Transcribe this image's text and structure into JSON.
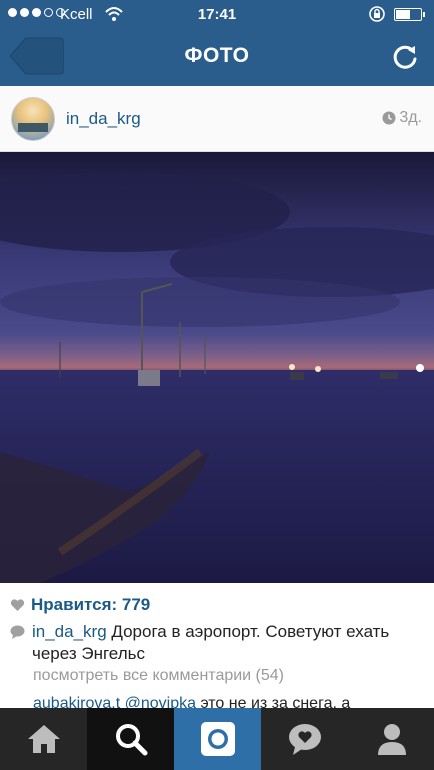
{
  "status_bar": {
    "carrier": "Kcell",
    "time": "17:41"
  },
  "nav": {
    "title": "ФОТО"
  },
  "post": {
    "username": "in_da_krg",
    "time_ago": "3д.",
    "likes_text": "Нравится: 779",
    "caption_user": "in_da_krg",
    "caption_text": " Дорога в аэропорт. Советуют ехать через Энгельс",
    "view_all_comments": "посмотреть все комментарии (54)",
    "comment_user": "aubakirova.t",
    "comment_mention": "@novipka",
    "comment_text": " это не из за снега, а"
  },
  "tab_bar": {
    "items": [
      "home-icon",
      "search-icon",
      "camera-icon",
      "activity-icon",
      "profile-icon"
    ]
  },
  "colors": {
    "header_blue": "#2a5d8b",
    "link_blue": "#1b5a88",
    "active_tab": "#2f6fa8",
    "tab_bar_bg": "#262626"
  }
}
